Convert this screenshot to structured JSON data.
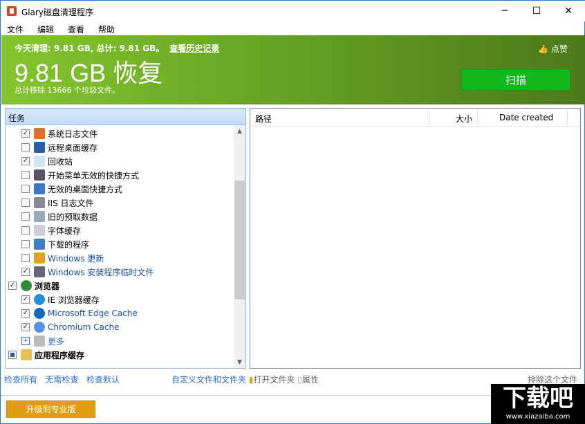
{
  "window": {
    "title": "Glary磁盘清理程序",
    "minimize": "─",
    "maximize": "☐",
    "close": "✕"
  },
  "menu": [
    "文件",
    "编辑",
    "查看",
    "帮助"
  ],
  "banner": {
    "today": "今天清理: 9.81 GB, 总计: 9.81 GB。",
    "history_link": "查看历史记录",
    "recovered": "9.81 GB 恢复",
    "removed": "总计移除 13666 个垃圾文件。",
    "like": "点赞",
    "scan": "扫描"
  },
  "tasks": {
    "header": "任务",
    "items": [
      {
        "label": "系统日志文件",
        "checked": true,
        "level": 1,
        "icon": "scissors-icon"
      },
      {
        "label": "远程桌面缓存",
        "checked": false,
        "level": 1,
        "icon": "remote-desktop-icon"
      },
      {
        "label": "回收站",
        "checked": true,
        "level": 1,
        "icon": "recycle-bin-icon"
      },
      {
        "label": "开始菜单无效的快捷方式",
        "checked": false,
        "level": 1,
        "icon": "shortcut-icon"
      },
      {
        "label": "无效的桌面快捷方式",
        "checked": false,
        "level": 1,
        "icon": "desktop-shortcut-icon"
      },
      {
        "label": "IIS 日志文件",
        "checked": false,
        "level": 1,
        "icon": "iis-log-icon"
      },
      {
        "label": "旧的预取数据",
        "checked": false,
        "level": 1,
        "icon": "prefetch-icon"
      },
      {
        "label": "字体缓存",
        "checked": false,
        "level": 1,
        "icon": "font-icon"
      },
      {
        "label": "下载的程序",
        "checked": false,
        "level": 1,
        "icon": "download-icon"
      },
      {
        "label": "Windows 更新",
        "checked": false,
        "level": 1,
        "icon": "windows-icon"
      },
      {
        "label": "Windows 安装程序临时文件",
        "checked": true,
        "level": 1,
        "icon": "installer-icon"
      },
      {
        "label": "浏览器",
        "checked": true,
        "level": 0,
        "icon": "globe-icon"
      },
      {
        "label": "IE 浏览器缓存",
        "checked": true,
        "level": 1,
        "icon": "ie-icon"
      },
      {
        "label": "Microsoft Edge Cache",
        "checked": true,
        "level": 1,
        "icon": "edge-icon"
      },
      {
        "label": "Chromium Cache",
        "checked": true,
        "level": 1,
        "icon": "chromium-icon"
      },
      {
        "label": "更多",
        "checked": null,
        "level": 1,
        "icon": "drive-icon"
      },
      {
        "label": "应用程序缓存",
        "checked": "partial",
        "level": 0,
        "icon": "app-folder-icon"
      }
    ]
  },
  "columns": {
    "path": "路径",
    "size": "大小",
    "date": "Date created"
  },
  "actions": {
    "check_all": "检查所有",
    "check_none": "无需检查",
    "check_default": "检查默认",
    "custom": "自定义文件和文件夹",
    "open_folder": "打开文件夹",
    "properties": "属性",
    "exclude": "排除这个文件"
  },
  "upgrade": "升级到专业版",
  "watermark": {
    "logo": "下载吧",
    "url": "www.xiazaiba.com"
  }
}
